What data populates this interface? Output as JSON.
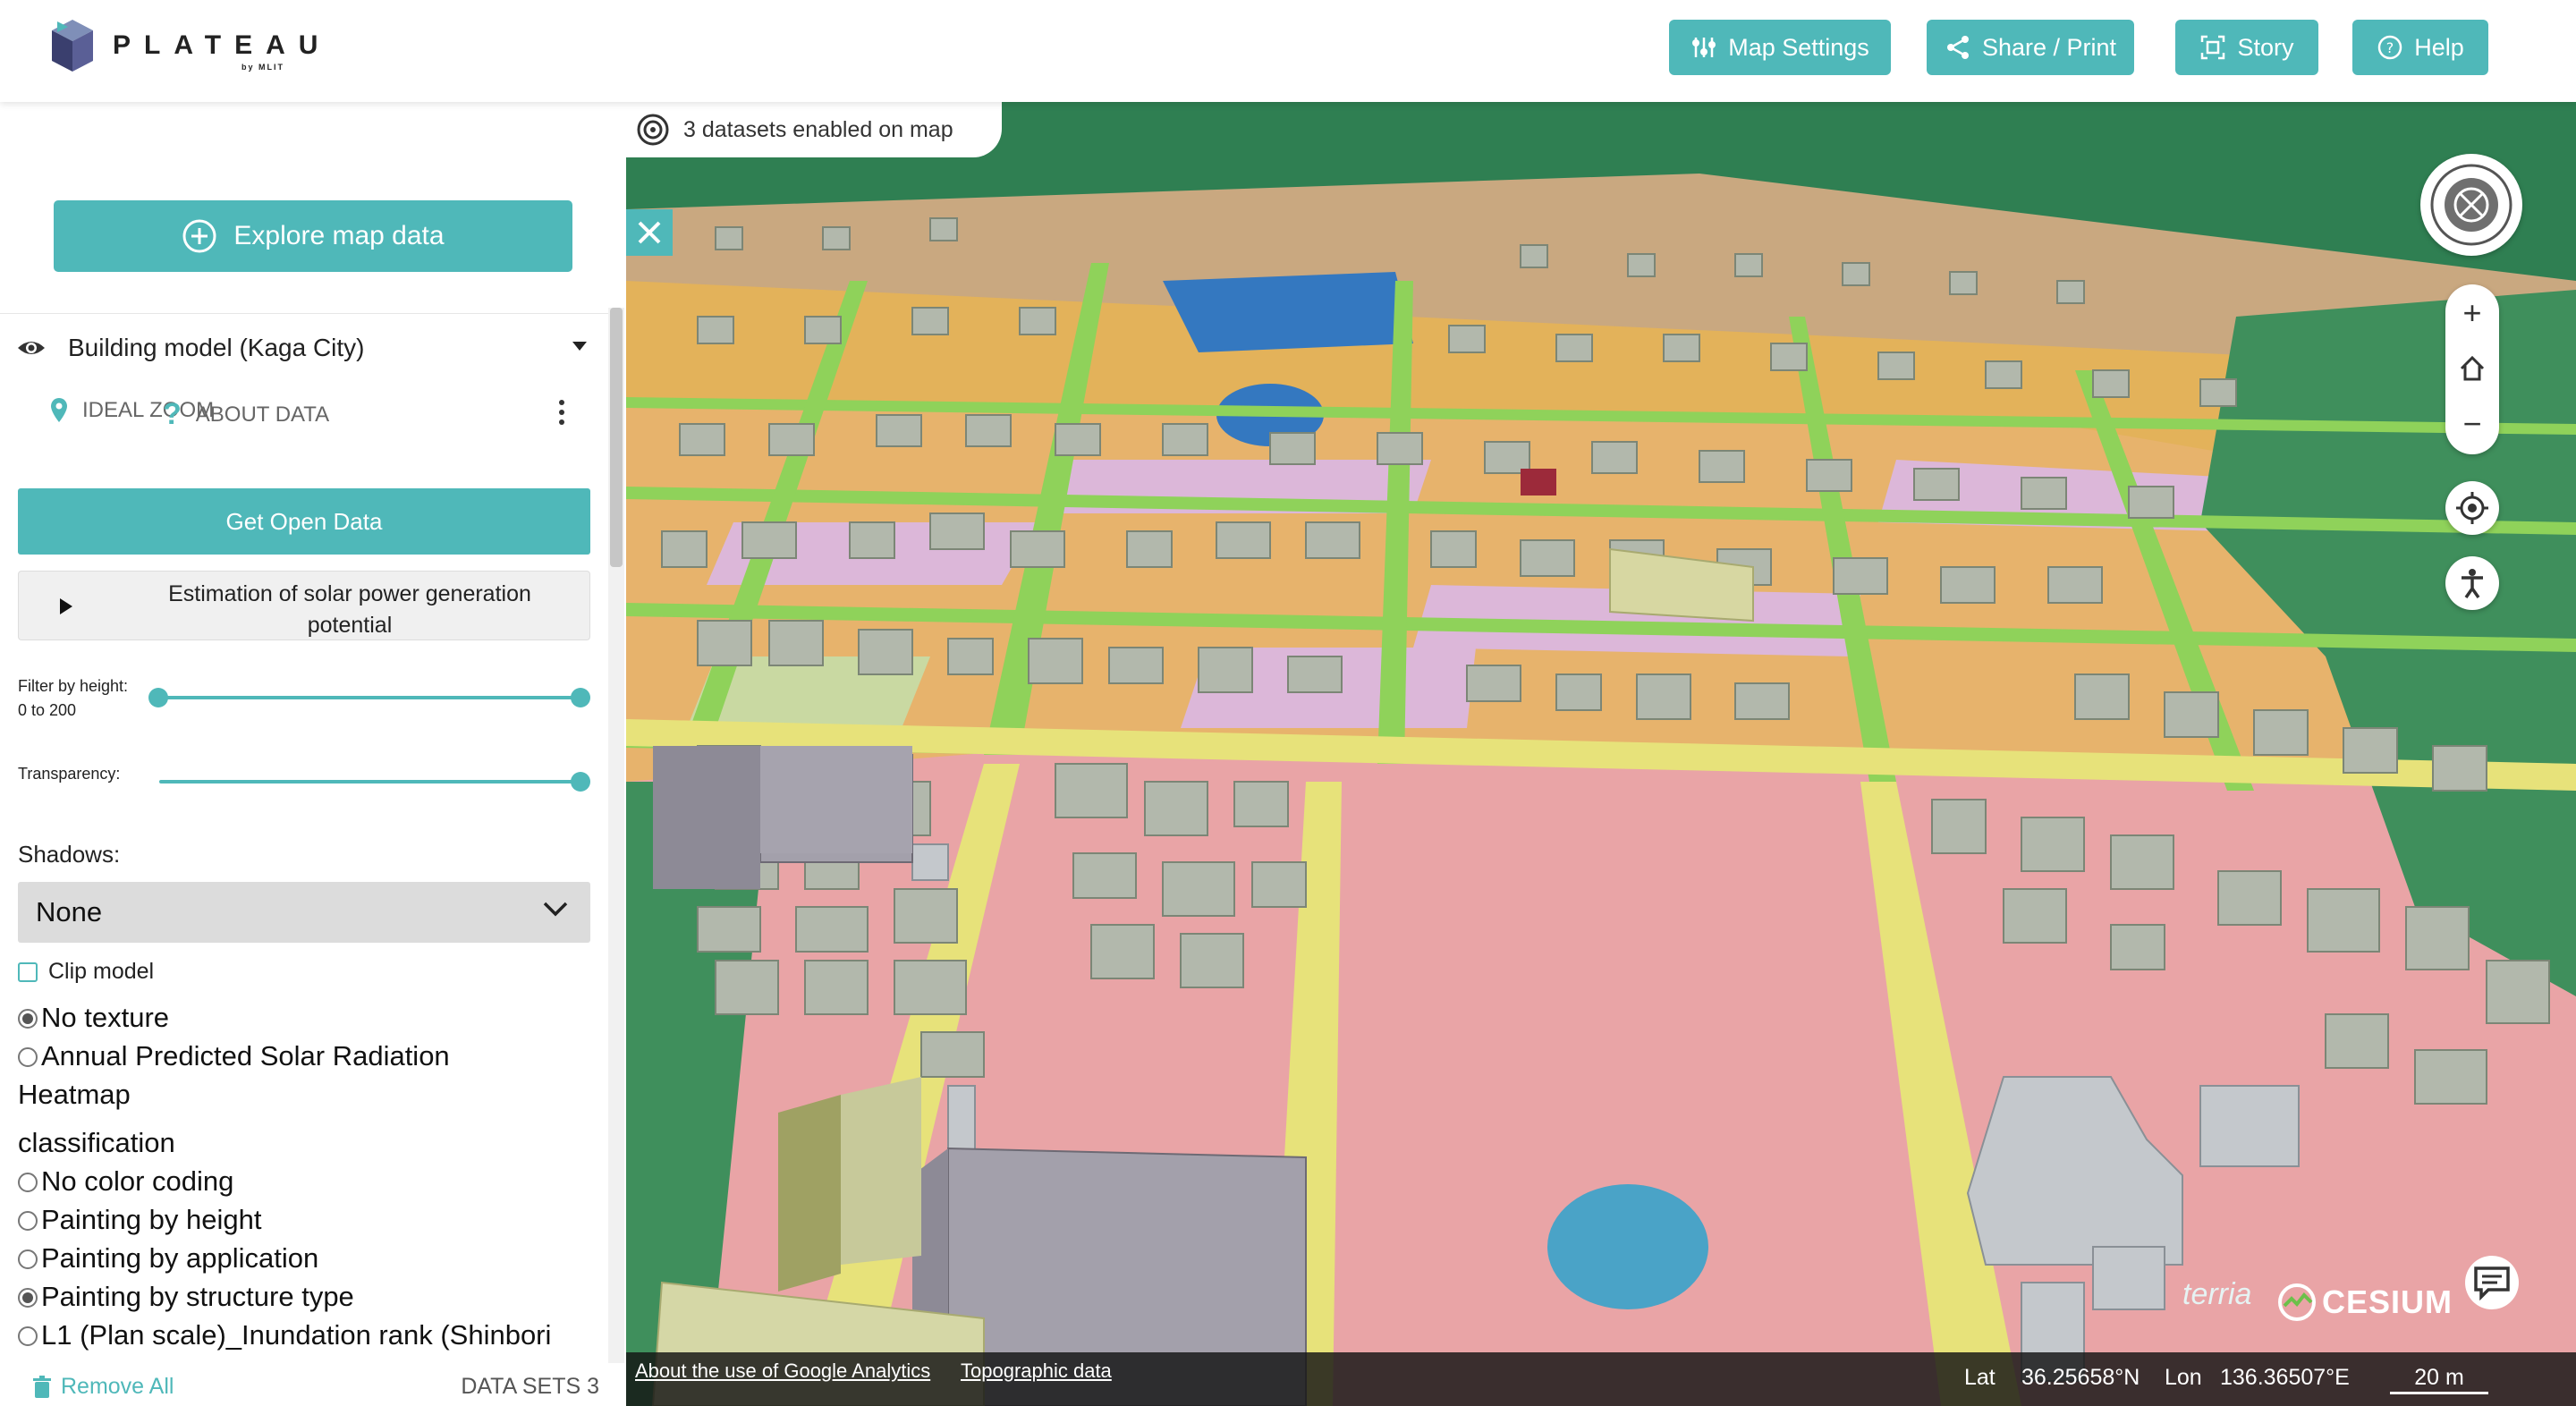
{
  "header": {
    "logo_text": "PLATEAU",
    "logo_sub": "by MLIT",
    "buttons": {
      "map_settings": "Map Settings",
      "share_print": "Share / Print",
      "story": "Story",
      "help": "Help"
    }
  },
  "sidebar": {
    "explore_label": "Explore map data",
    "dataset": {
      "title": "Building model (Kaga City)",
      "ideal_zoom": "IDEAL ZOOM",
      "about_data": "ABOUT DATA",
      "get_open_data": "Get Open Data",
      "solar_line1": "Estimation of solar power generation",
      "solar_line2": "potential",
      "filter_label": "Filter by height:",
      "filter_range": "0 to 200",
      "filter_min": 0,
      "filter_max": 200,
      "transparency_label": "Transparency:",
      "transparency_value": 1.0,
      "shadows_label": "Shadows:",
      "shadows_value": "None",
      "clip_model_label": "Clip model",
      "texture_options": [
        {
          "label": "No texture",
          "selected": true
        },
        {
          "label": "Annual Predicted Solar Radiation",
          "selected": false
        }
      ],
      "heatmap_label": "Heatmap",
      "classification_label": "classification",
      "color_options": [
        {
          "label": "No color coding",
          "selected": false
        },
        {
          "label": "Painting by height",
          "selected": false
        },
        {
          "label": "Painting by application",
          "selected": false
        },
        {
          "label": "Painting by structure type",
          "selected": true
        },
        {
          "label": "L1 (Plan scale)_Inundation rank (Shinbori",
          "selected": false
        }
      ]
    },
    "remove_all": "Remove All",
    "datasets_count": "DATA SETS 3"
  },
  "map": {
    "enabled_pill": "3 datasets enabled on map",
    "attribution_links": [
      "About the use of Google Analytics",
      "Topographic data"
    ],
    "lat_label": "Lat",
    "lat_value": "36.25658°N",
    "lon_label": "Lon",
    "lon_value": "136.36507°E",
    "scale": "20 m",
    "terria_label": "terria",
    "cesium_label": "CESIUM"
  },
  "colors": {
    "accent": "#4fb8b9",
    "road": "#8fd25a",
    "commercial_pink": "#e7a3a6",
    "residential_orange": "#f1b650",
    "park_green": "#3f8f5c",
    "water": "#2e7fc6",
    "building_gray": "#b2b8ac"
  },
  "icons": [
    "plateau-logo-icon",
    "sliders-icon",
    "share-icon",
    "story-icon",
    "help-icon",
    "plus-circle-icon",
    "eye-icon",
    "pin-icon",
    "question-icon",
    "kebab-icon",
    "chevron-down-icon",
    "trash-icon",
    "layers-icon",
    "close-icon",
    "compass-icon",
    "zoom-in-icon",
    "home-icon",
    "zoom-out-icon",
    "locate-icon",
    "pedestrian-icon",
    "feedback-icon"
  ]
}
